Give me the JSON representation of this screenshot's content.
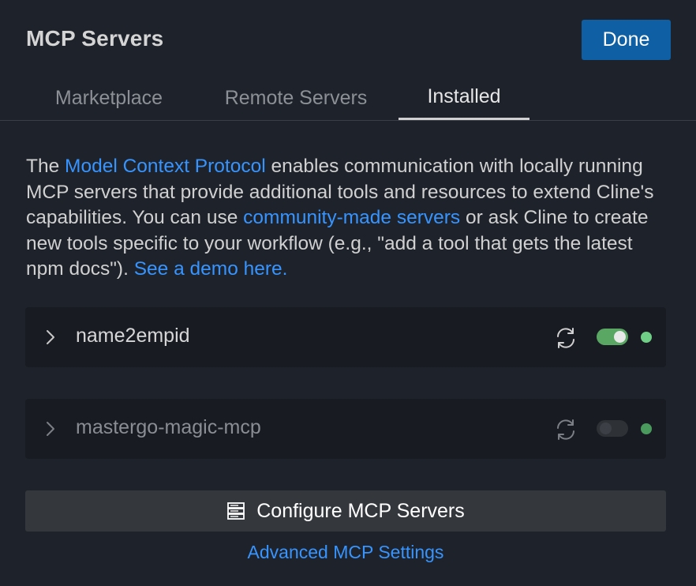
{
  "header": {
    "title": "MCP Servers",
    "done_label": "Done"
  },
  "tabs": [
    {
      "label": "Marketplace",
      "active": false
    },
    {
      "label": "Remote Servers",
      "active": false
    },
    {
      "label": "Installed",
      "active": true
    }
  ],
  "description": {
    "part1": "The ",
    "link1": "Model Context Protocol",
    "part2": " enables communication with locally running MCP servers that provide additional tools and resources to extend Cline's capabilities. You can use ",
    "link2": "community-made servers",
    "part3": " or ask Cline to create new tools specific to your workflow (e.g., \"add a tool that gets the latest npm docs\"). ",
    "link3": "See a demo here."
  },
  "servers": [
    {
      "name": "name2empid",
      "enabled": true,
      "status": "connected",
      "icons": [
        "chevron-right-icon",
        "refresh-icon"
      ]
    },
    {
      "name": "mastergo-magic-mcp",
      "enabled": false,
      "status": "connected",
      "icons": [
        "chevron-right-icon",
        "refresh-icon"
      ]
    }
  ],
  "configure": {
    "label": "Configure MCP Servers",
    "icon": "server-icon"
  },
  "advanced_link": "Advanced MCP Settings",
  "colors": {
    "background": "#1e232b",
    "accent_button": "#0e5fa4",
    "link": "#3794ff",
    "toggle_on": "#5aa764",
    "status_connected": "#6fcf86"
  }
}
